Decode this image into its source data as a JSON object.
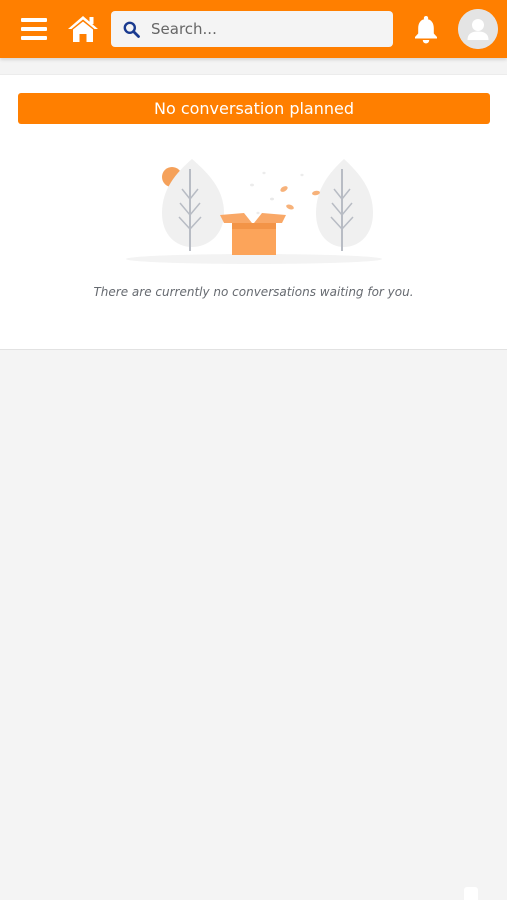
{
  "header": {
    "menu_icon": "hamburger-menu-icon",
    "home_icon": "home-icon",
    "search": {
      "icon": "search-icon",
      "placeholder": "Search...",
      "value": ""
    },
    "notifications_icon": "bell-icon",
    "avatar_icon": "user-avatar-icon"
  },
  "main": {
    "banner_text": "No conversation planned",
    "illustration": "empty-box-trees-illustration",
    "empty_message": "There are currently no conversations waiting for you."
  },
  "colors": {
    "brand_orange": "#ff7f00",
    "search_icon_blue": "#1a3a8f",
    "page_background": "#f4f4f4",
    "card_background": "#ffffff",
    "muted_text": "#666a70"
  }
}
